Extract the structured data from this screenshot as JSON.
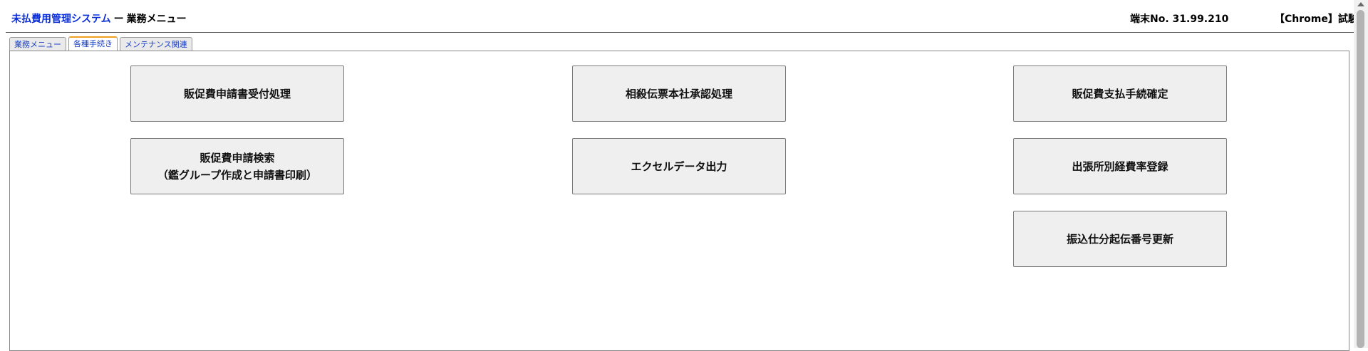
{
  "header": {
    "system_name": "未払費用管理システム",
    "separator": "ー",
    "page_name": "業務メニュー",
    "terminal": "端末No. 31.99.210",
    "environment": "【Chrome】試験"
  },
  "tabs": [
    {
      "label": "業務メニュー",
      "active": false
    },
    {
      "label": "各種手続き",
      "active": true
    },
    {
      "label": "メンテナンス関連",
      "active": false
    }
  ],
  "buttons": {
    "sales_promo_application_receipt": "販促費申請書受付処理",
    "offset_slip_hq_approval": "相殺伝票本社承認処理",
    "sales_promo_payment_confirm": "販促費支払手続確定",
    "sales_promo_search_line1": "販促費申請検索",
    "sales_promo_search_line2": "（鑑グループ作成と申請書印刷）",
    "excel_data_output": "エクセルデータ出力",
    "branch_expense_rate_registration": "出張所別経費率登録",
    "transfer_slip_number_update": "振込仕分起伝番号更新"
  },
  "colors": {
    "system_name": "#0b2fd6",
    "active_tab_accent": "#f0a020",
    "button_bg": "#efefef"
  }
}
